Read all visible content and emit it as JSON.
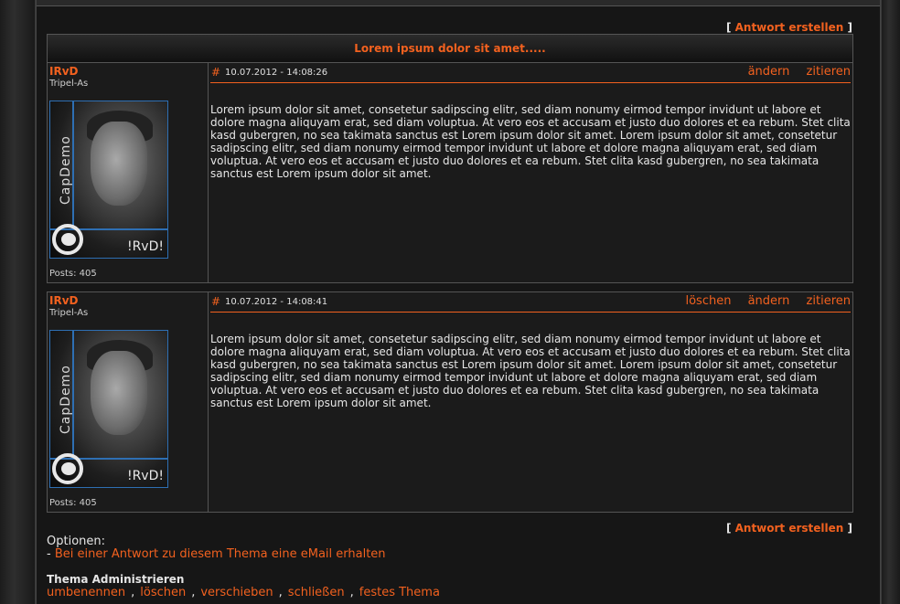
{
  "reply": {
    "open": "[",
    "label": "Antwort erstellen",
    "close": "]"
  },
  "topic_title": "Lorem ipsum dolor sit amet.....",
  "posts": [
    {
      "username": "IRvD",
      "rank": "Tripel-As",
      "avatar_text": "CapDemo",
      "avatar_tag": "!RvD!",
      "post_count": "Posts: 405",
      "hash": "#",
      "date": "10.07.2012 - 14:08:26",
      "actions": [
        "ändern",
        "zitieren"
      ],
      "body": "Lorem ipsum dolor sit amet, consetetur sadipscing elitr, sed diam nonumy eirmod tempor invidunt ut labore et dolore magna aliquyam erat, sed diam voluptua. At vero eos et accusam et justo duo dolores et ea rebum. Stet clita kasd gubergren, no sea takimata sanctus est Lorem ipsum dolor sit amet. Lorem ipsum dolor sit amet, consetetur sadipscing elitr, sed diam nonumy eirmod tempor invidunt ut labore et dolore magna aliquyam erat, sed diam voluptua. At vero eos et accusam et justo duo dolores et ea rebum. Stet clita kasd gubergren, no sea takimata sanctus est Lorem ipsum dolor sit amet."
    },
    {
      "username": "IRvD",
      "rank": "Tripel-As",
      "avatar_text": "CapDemo",
      "avatar_tag": "!RvD!",
      "post_count": "Posts: 405",
      "hash": "#",
      "date": "10.07.2012 - 14:08:41",
      "actions": [
        "löschen",
        "ändern",
        "zitieren"
      ],
      "body": "Lorem ipsum dolor sit amet, consetetur sadipscing elitr, sed diam nonumy eirmod tempor invidunt ut labore et dolore magna aliquyam erat, sed diam voluptua. At vero eos et accusam et justo duo dolores et ea rebum. Stet clita kasd gubergren, no sea takimata sanctus est Lorem ipsum dolor sit amet. Lorem ipsum dolor sit amet, consetetur sadipscing elitr, sed diam nonumy eirmod tempor invidunt ut labore et dolore magna aliquyam erat, sed diam voluptua. At vero eos et accusam et justo duo dolores et ea rebum. Stet clita kasd gubergren, no sea takimata sanctus est Lorem ipsum dolor sit amet."
    }
  ],
  "options": {
    "label": "Optionen:",
    "prefix": "- ",
    "email_link": "Bei einer Antwort zu diesem Thema eine eMail erhalten"
  },
  "admin": {
    "title": "Thema Administrieren",
    "links": [
      "umbenennen",
      "löschen",
      "verschieben",
      "schließen",
      "festes Thema"
    ],
    "separator": ","
  },
  "colors": {
    "accent": "#f2611f",
    "avatar_border": "#2e6fb3",
    "background": "#161616"
  }
}
